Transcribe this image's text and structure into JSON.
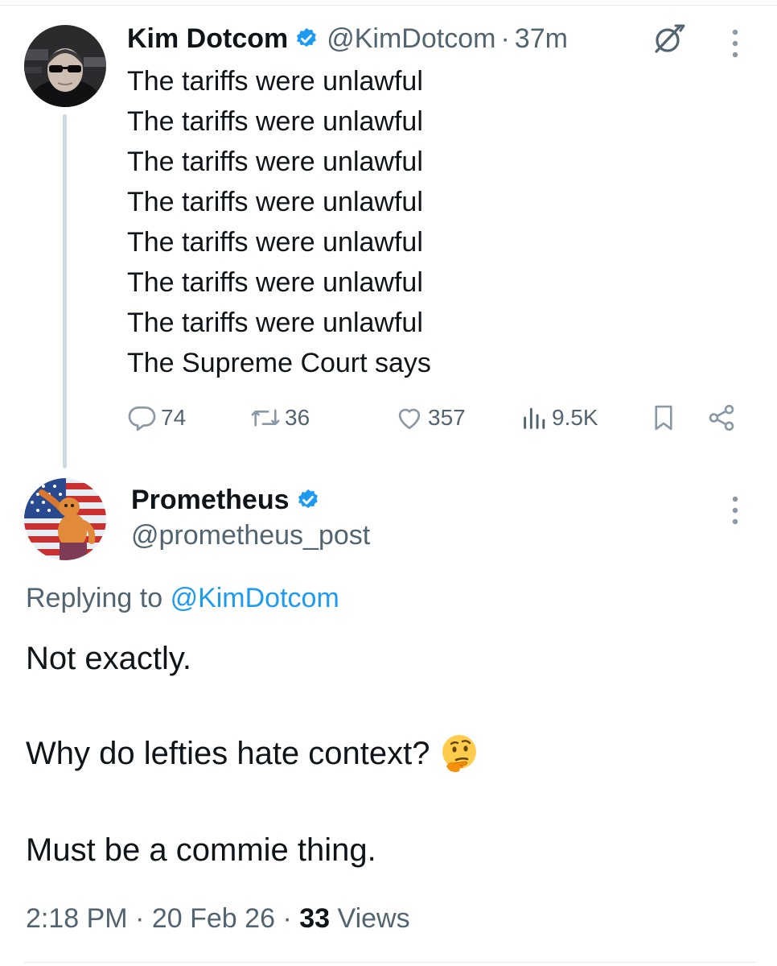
{
  "parent_tweet": {
    "display_name": "Kim Dotcom",
    "handle": "@KimDotcom",
    "separator": "·",
    "time": "37m",
    "lines": [
      "The tariffs were unlawful",
      "The tariffs were unlawful",
      "The tariffs were unlawful",
      "The tariffs were unlawful",
      "The tariffs were unlawful",
      "The tariffs were unlawful",
      "The tariffs were unlawful",
      "The Supreme Court says"
    ],
    "actions": {
      "replies": "74",
      "retweets": "36",
      "likes": "357",
      "views": "9.5K"
    },
    "icons": [
      "grok-icon",
      "more-icon",
      "reply-icon",
      "retweet-icon",
      "like-icon",
      "views-icon",
      "bookmark-icon",
      "share-icon",
      "verified-badge-icon"
    ]
  },
  "reply_tweet": {
    "display_name": "Prometheus",
    "handle": "@prometheus_post",
    "replying_prefix": "Replying to",
    "replying_to": "@KimDotcom",
    "text_lines": [
      "Not exactly.",
      "Why do lefties hate context?",
      "Must be a commie thing."
    ],
    "emoji": "thinking-face-icon",
    "timestamp": "2:18 PM",
    "date": "20 Feb 26",
    "separator": "·",
    "view_count": "33",
    "views_label": "Views"
  },
  "colors": {
    "text_primary": "#0f1419",
    "text_secondary": "#536471",
    "accent_blue": "#1d9bf0",
    "thread_line": "#cfd9de"
  }
}
